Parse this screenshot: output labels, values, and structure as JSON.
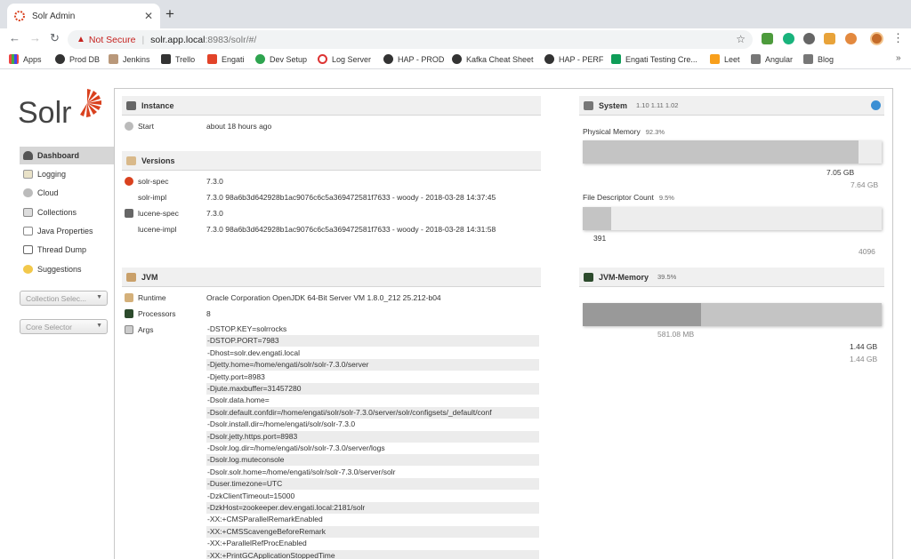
{
  "browser": {
    "tab_title": "Solr Admin",
    "not_secure": "Not Secure",
    "url_host": "solr.app.local",
    "url_path": ":8983/solr/#/",
    "bookmarks": [
      "Apps",
      "Prod DB",
      "Jenkins",
      "Trello",
      "Engati",
      "Dev Setup",
      "Log Server",
      "HAP - PROD",
      "Kafka Cheat Sheet",
      "HAP - PERF",
      "Engati Testing Cre...",
      "Leet",
      "Angular",
      "Blog"
    ]
  },
  "sidebar": {
    "logo": "Solr",
    "items": [
      "Dashboard",
      "Logging",
      "Cloud",
      "Collections",
      "Java Properties",
      "Thread Dump",
      "Suggestions"
    ],
    "collection_selector": "Collection Selec...",
    "core_selector": "Core Selector"
  },
  "instance": {
    "title": "Instance",
    "start_label": "Start",
    "start_value": "about 18 hours ago"
  },
  "versions": {
    "title": "Versions",
    "rows": [
      {
        "label": "solr-spec",
        "value": "7.3.0"
      },
      {
        "label": "solr-impl",
        "value": "7.3.0 98a6b3d642928b1ac9076c6c5a369472581f7633 - woody - 2018-03-28 14:37:45"
      },
      {
        "label": "lucene-spec",
        "value": "7.3.0"
      },
      {
        "label": "lucene-impl",
        "value": "7.3.0 98a6b3d642928b1ac9076c6c5a369472581f7633 - woody - 2018-03-28 14:31:58"
      }
    ]
  },
  "jvm": {
    "title": "JVM",
    "runtime_label": "Runtime",
    "runtime_value": "Oracle Corporation OpenJDK 64-Bit Server VM 1.8.0_212 25.212-b04",
    "processors_label": "Processors",
    "processors_value": "8",
    "args_label": "Args",
    "args": [
      "-DSTOP.KEY=solrrocks",
      "-DSTOP.PORT=7983",
      "-Dhost=solr.dev.engati.local",
      "-Djetty.home=/home/engati/solr/solr-7.3.0/server",
      "-Djetty.port=8983",
      "-Djute.maxbuffer=31457280",
      "-Dsolr.data.home=",
      "-Dsolr.default.confdir=/home/engati/solr/solr-7.3.0/server/solr/configsets/_default/conf",
      "-Dsolr.install.dir=/home/engati/solr/solr-7.3.0",
      "-Dsolr.jetty.https.port=8983",
      "-Dsolr.log.dir=/home/engati/solr/solr-7.3.0/server/logs",
      "-Dsolr.log.muteconsole",
      "-Dsolr.solr.home=/home/engati/solr/solr-7.3.0/server/solr",
      "-Duser.timezone=UTC",
      "-DzkClientTimeout=15000",
      "-DzkHost=zookeeper.dev.engati.local:2181/solr",
      "-XX:+CMSParallelRemarkEnabled",
      "-XX:+CMSScavengeBeforeRemark",
      "-XX:+ParallelRefProcEnabled",
      "-XX:+PrintGCApplicationStoppedTime"
    ]
  },
  "system": {
    "title": "System",
    "load": "1.10 1.11 1.02",
    "physical_memory": {
      "label": "Physical Memory",
      "percent": "92.3%",
      "fraction": 0.923,
      "used": "7.05 GB",
      "total": "7.64 GB"
    },
    "file_descriptor": {
      "label": "File Descriptor Count",
      "percent": "9.5%",
      "fraction": 0.095,
      "used": "391",
      "total": "4096"
    }
  },
  "jvm_memory": {
    "title": "JVM-Memory",
    "percent": "39.5%",
    "used_fraction": 0.395,
    "committed_fraction": 1.0,
    "used": "581.08 MB",
    "committed": "1.44 GB",
    "max": "1.44 GB"
  }
}
